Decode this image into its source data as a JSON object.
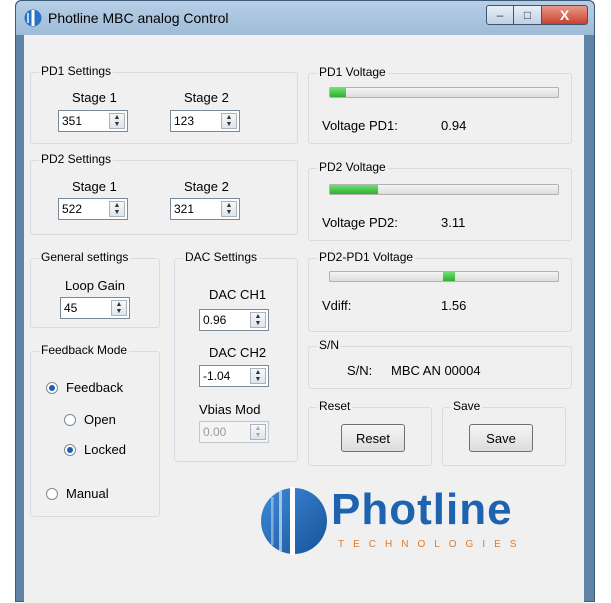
{
  "window": {
    "title": "Photline MBC analog Control",
    "minimize": "–",
    "maximize": "□",
    "close": "X"
  },
  "pd1_settings": {
    "title": "PD1 Settings",
    "stage1_label": "Stage 1",
    "stage2_label": "Stage 2",
    "stage1_value": "351",
    "stage2_value": "123"
  },
  "pd2_settings": {
    "title": "PD2 Settings",
    "stage1_label": "Stage 1",
    "stage2_label": "Stage 2",
    "stage1_value": "522",
    "stage2_value": "321"
  },
  "general": {
    "title": "General settings",
    "loop_gain_label": "Loop Gain",
    "loop_gain_value": "45"
  },
  "dac": {
    "title": "DAC Settings",
    "ch1_label": "DAC CH1",
    "ch1_value": "0.96",
    "ch2_label": "DAC CH2",
    "ch2_value": "-1.04",
    "vbias_label": "Vbias Mod",
    "vbias_value": "0.00"
  },
  "feedback": {
    "title": "Feedback Mode",
    "feedback_label": "Feedback",
    "open_label": "Open",
    "locked_label": "Locked",
    "manual_label": "Manual"
  },
  "pd1_voltage": {
    "title": "PD1 Voltage",
    "label": "Voltage PD1:",
    "value": "0.94",
    "level": 0.07
  },
  "pd2_voltage": {
    "title": "PD2 Voltage",
    "label": "Voltage PD2:",
    "value": "3.11",
    "level": 0.21
  },
  "diff_voltage": {
    "title": "PD2-PD1 Voltage",
    "label": "Vdiff:",
    "value": "1.56",
    "level": 0.52
  },
  "sn": {
    "title": "S/N",
    "label": "S/N:",
    "value": "MBC AN 00004"
  },
  "reset": {
    "title": "Reset",
    "button": "Reset"
  },
  "save": {
    "title": "Save",
    "button": "Save"
  },
  "logo": {
    "name": "Photline",
    "tagline": "TECHNOLOGIES"
  },
  "spinner_arrows": {
    "up": "▲",
    "down": "▼"
  },
  "colors": {
    "progress": "#2eb02e",
    "logo_blue": "#1e63b0",
    "logo_orange": "#e07a2a"
  }
}
